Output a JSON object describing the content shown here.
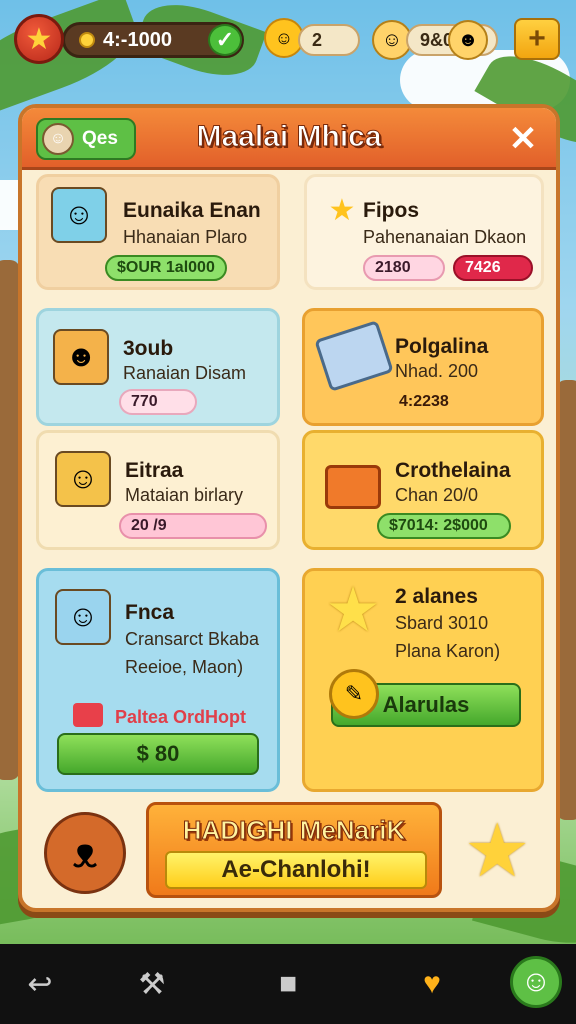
{
  "hud": {
    "coins": "4:-1000",
    "sun_value": "2",
    "gems_value": "9&0"
  },
  "panel": {
    "title": "Maalai Mhica",
    "tab_label": "Qes",
    "close_glyph": "✕"
  },
  "cards": [
    {
      "title": "Eunaika Enan",
      "sub": "Hhanaian Plaro",
      "pill": "$OUR 1al000"
    },
    {
      "title": "Fipos",
      "sub": "Pahenanaian Dkaon",
      "pill_a": "2180",
      "pill_b": "7426"
    },
    {
      "title": "3oub",
      "sub": "Ranaian Disam",
      "pill": "770"
    },
    {
      "title": "Polgalina",
      "sub": "Nhad. 200",
      "pill": "4:2238"
    },
    {
      "title": "Eitraa",
      "sub": "Mataian birlary",
      "pill": "20 /9"
    },
    {
      "title": "Crothelaina",
      "sub": "Chan 20/0",
      "pill": "$7014: 2$000"
    },
    {
      "title": "Fnca",
      "sub": "Cransarct Bkaba",
      "sub2": "Reeioe, Maon)",
      "label": "Paltea OrdHopt",
      "button": "$ 80"
    },
    {
      "title": "2 alanes",
      "sub": "Sbard 3010",
      "sub2": "Plana Karon)",
      "button": "Alarulas"
    }
  ],
  "banner": {
    "title": "HADIGHI MeNariK",
    "button": "Ae-Chanlohi!"
  },
  "icons": {
    "back": "back-arrow-icon",
    "home": "home-square-icon",
    "tool": "hammer-icon",
    "fruit": "fruit-icon",
    "profile": "profile-icon"
  }
}
